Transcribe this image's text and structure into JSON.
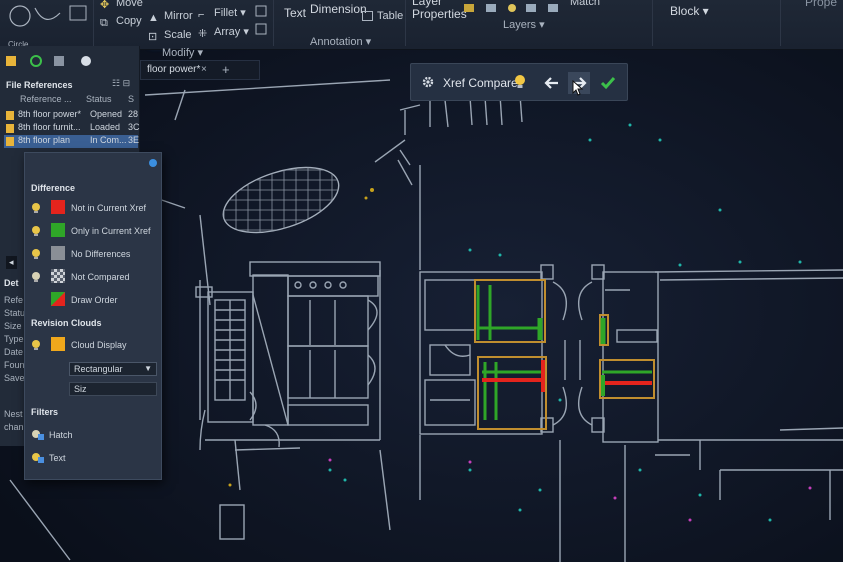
{
  "ribbon": {
    "tools_row1": [
      "Move",
      "Copy",
      "Mirror",
      "Fillet",
      "Text",
      "Dimension"
    ],
    "tools_row2": [
      "Scale",
      "Array",
      "Table"
    ],
    "layer_props_line1": "Layer",
    "layer_props_line2": "Properties",
    "layers_label": "Layers",
    "block_label": "Block",
    "props_label": "Prope",
    "group_modify": "Modify",
    "group_annotation": "Annotation",
    "top_left_fragment": "Circle",
    "top_right_fragment": "Match"
  },
  "tabs": {
    "active_doc": "floor power*",
    "close_glyph": "×",
    "plus_glyph": "+"
  },
  "xref_toolbar": {
    "title": "Xref Compare",
    "icons": [
      "gear-icon",
      "bulb-icon",
      "arrow-left-icon",
      "arrow-right-icon",
      "check-icon"
    ]
  },
  "file_refs": {
    "title": "File References",
    "columns": [
      "Reference ...",
      "Status",
      "S"
    ],
    "rows": [
      {
        "name": "8th floor power*",
        "status": "Opened",
        "size": "28"
      },
      {
        "name": "8th floor furnit...",
        "status": "Loaded",
        "size": "3C"
      },
      {
        "name": "8th floor plan",
        "status": "In Com...",
        "size": "3E"
      }
    ],
    "details_title": "Det",
    "detail_rows": [
      "Refe",
      "Statu",
      "Size",
      "Type",
      "Date",
      "Foun",
      "Save"
    ],
    "footer_lines": [
      "Nest",
      "chan"
    ]
  },
  "compare_panel": {
    "difference_title": "Difference",
    "difference_items": [
      {
        "label": "Not in Current Xref",
        "color": "#e4241d"
      },
      {
        "label": "Only in Current Xref",
        "color": "#2fa628"
      },
      {
        "label": "No Differences",
        "color": "#8a8f96"
      },
      {
        "label": "Not Compared",
        "color": "checker"
      },
      {
        "label": "Draw Order",
        "color": "order"
      }
    ],
    "revision_title": "Revision Clouds",
    "cloud_display_label": "Cloud Display",
    "cloud_color": "#f0a81c",
    "shape_value": "Rectangular",
    "size_value": "Siz",
    "filters_title": "Filters",
    "filter_items": [
      "Hatch",
      "Text"
    ]
  },
  "colors": {
    "accent_blue": "#2d86e8",
    "canvas_bg": "#0c1220",
    "not_in_xref": "#e4241d",
    "only_in_xref": "#2fa628",
    "revision_cloud": "#d19b2a"
  }
}
